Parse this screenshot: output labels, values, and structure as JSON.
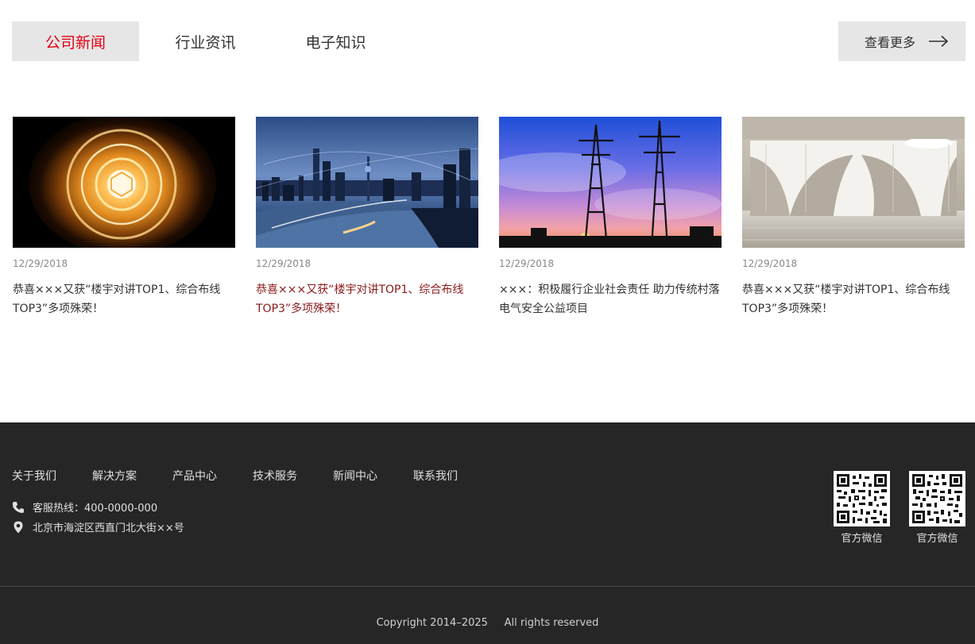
{
  "tabs": [
    {
      "label": "公司新闻",
      "active": true
    },
    {
      "label": "行业资讯",
      "active": false
    },
    {
      "label": "电子知识",
      "active": false
    }
  ],
  "more_label": "查看更多",
  "news": [
    {
      "date": "12/29/2018",
      "title": "恭喜×××又获“楼宇对讲TOP1、综合布线TOP3”多项殊荣！",
      "image": "glowing-light-bulb"
    },
    {
      "date": "12/29/2018",
      "title": "恭喜×××又获“楼宇对讲TOP1、综合布线TOP3”多项殊荣！",
      "image": "city-skyline-night"
    },
    {
      "date": "12/29/2018",
      "title": "×××：积极履行企业社会责任 助力传统村落电气安全公益项目",
      "image": "power-pylons-sunset"
    },
    {
      "date": "12/29/2018",
      "title": "恭喜×××又获“楼宇对讲TOP1、综合布线TOP3”多项殊荣！",
      "image": "concrete-arched-room"
    }
  ],
  "footer": {
    "nav": [
      "关于我们",
      "解决方案",
      "产品中心",
      "技术服务",
      "新闻中心",
      "联系我们"
    ],
    "hotline": "客服热线：400-0000-000",
    "address": "北京市海淀区西直门北大街××号",
    "qr_codes": [
      {
        "label": "官方微信"
      },
      {
        "label": "官方微信"
      }
    ],
    "copyright": "Copyright 2014–2025     All rights reserved"
  },
  "colors": {
    "accent": "#e60012",
    "active_title": "#8b1a1a",
    "footer_bg": "#262626",
    "tab_bg": "#e6e6e6"
  }
}
